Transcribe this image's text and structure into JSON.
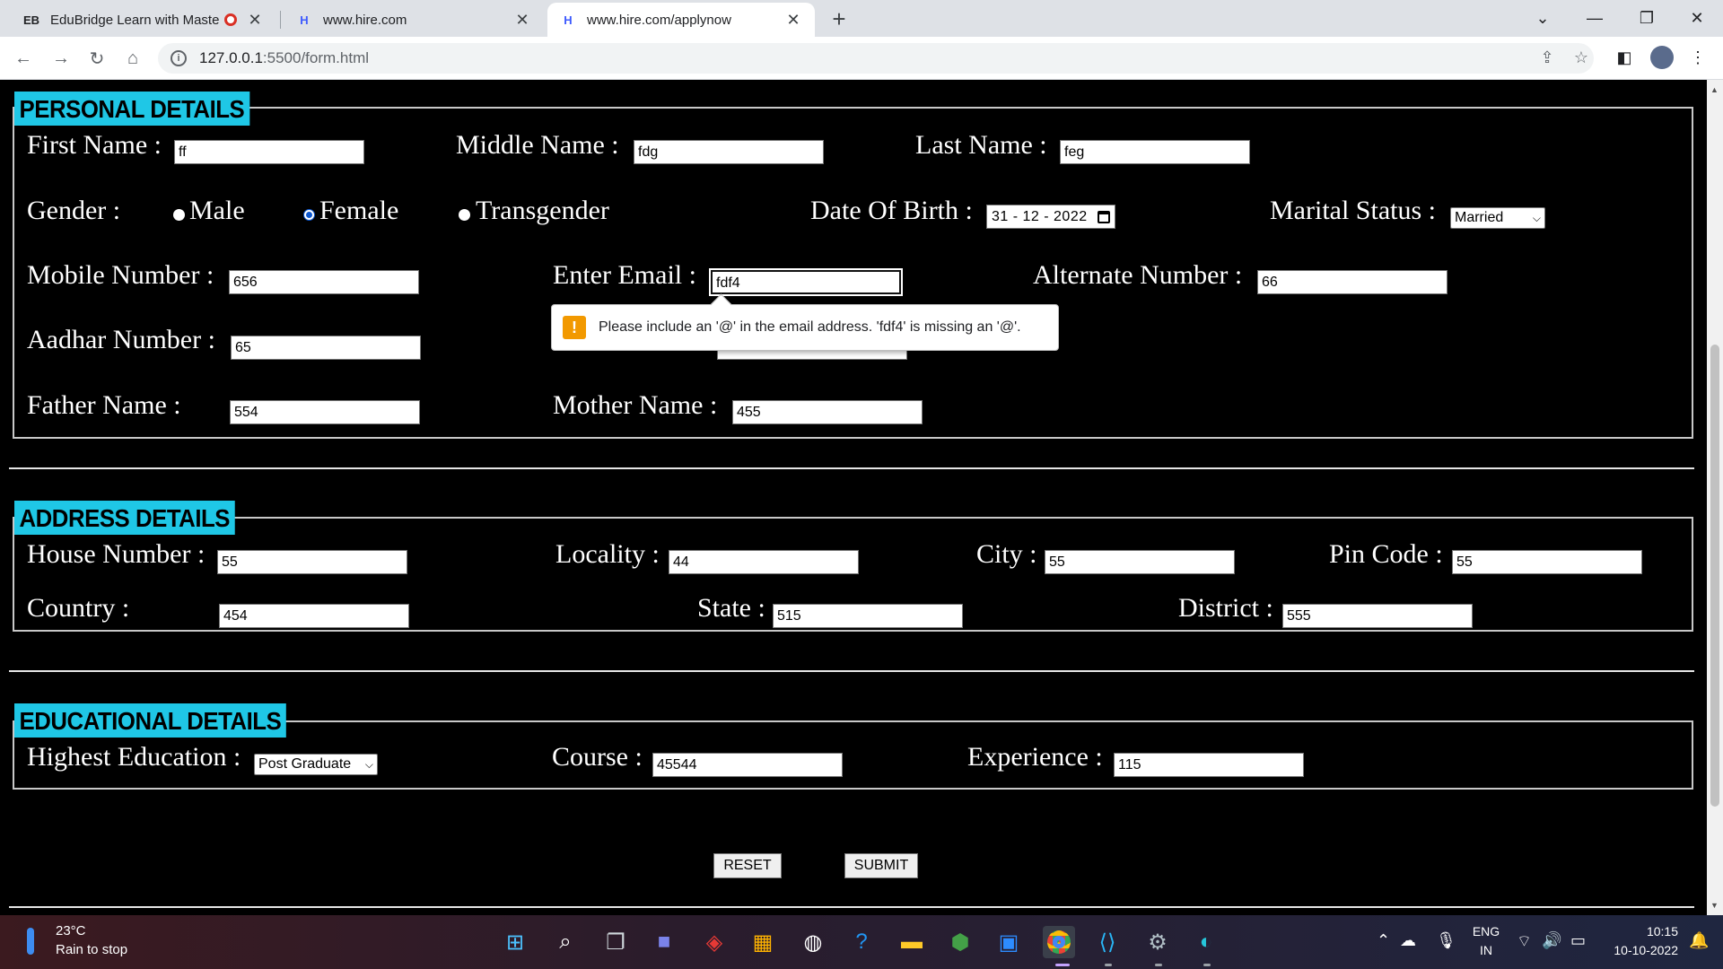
{
  "browser": {
    "tabs": [
      {
        "favicon": "EB",
        "title": "EduBridge Learn with Master",
        "recording": true
      },
      {
        "favicon": "H",
        "title": "www.hire.com"
      },
      {
        "favicon": "H",
        "title": "www.hire.com/applynow"
      }
    ],
    "new_tab": "+",
    "url_host": "127.0.0.1",
    "url_path": ":5500/form.html"
  },
  "personal": {
    "legend": "PERSONAL DETAILS",
    "first_name_label": "First Name :",
    "first_name_value": "ff",
    "middle_name_label": "Middle Name :",
    "middle_name_value": "fdg",
    "last_name_label": "Last Name :",
    "last_name_value": "feg",
    "gender_label": "Gender :",
    "gender_options": [
      "Male",
      "Female",
      "Transgender"
    ],
    "gender_selected": "Female",
    "dob_label": "Date Of Birth :",
    "dob_value": "31 - 12 - 2022",
    "marital_label": "Marital Status :",
    "marital_value": "Married",
    "mobile_label": "Mobile Number :",
    "mobile_value": "656",
    "email_label": "Enter Email :",
    "email_value": "fdf4",
    "alternate_label": "Alternate Number :",
    "alternate_value": "66",
    "aadhar_label": "Aadhar Number :",
    "aadhar_value": "65",
    "father_label": "Father Name :",
    "father_value": "554",
    "mother_label": "Mother Name :",
    "mother_value": "455"
  },
  "validation": {
    "message": "Please include an '@' in the email address. 'fdf4' is missing an '@'."
  },
  "address": {
    "legend": "ADDRESS DETAILS",
    "house_label": "House Number :",
    "house_value": "55",
    "locality_label": "Locality :",
    "locality_value": "44",
    "city_label": "City :",
    "city_value": "55",
    "pin_label": "Pin Code :",
    "pin_value": "55",
    "country_label": "Country :",
    "country_value": "454",
    "state_label": "State :",
    "state_value": "515",
    "district_label": "District :",
    "district_value": "555"
  },
  "education": {
    "legend": "EDUCATIONAL DETAILS",
    "highest_label": "Highest Education :",
    "highest_value": "Post Graduate",
    "course_label": "Course :",
    "course_value": "45544",
    "experience_label": "Experience :",
    "experience_value": "115"
  },
  "actions": {
    "reset": "RESET",
    "submit": "SUBMIT"
  },
  "taskbar": {
    "temperature": "23°C",
    "weather": "Rain to stop",
    "lang": "ENG",
    "region": "IN",
    "time": "10:15",
    "date": "10-10-2022"
  },
  "colors": {
    "legend_bg": "#1fc7e6",
    "page_bg": "#000000",
    "warning": "#f29900"
  }
}
